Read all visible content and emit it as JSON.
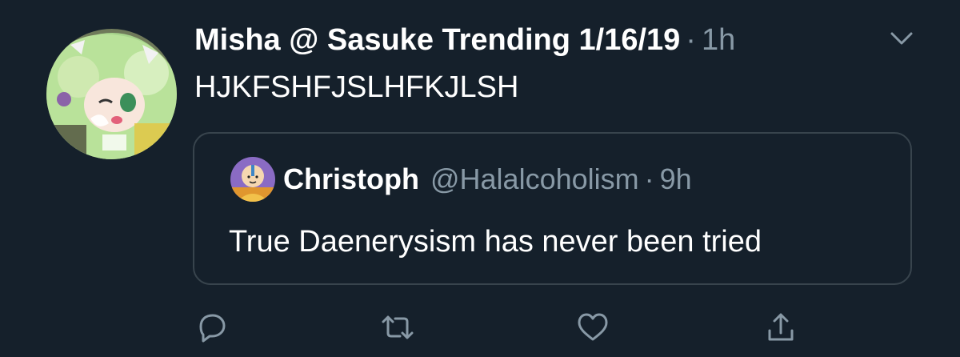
{
  "tweet": {
    "display_name": "Misha @ Sasuke Trending 1/16/19",
    "separator": "·",
    "time": "1h",
    "text": "HJKFSHFJSLHFKJLSH",
    "avatar_icon": "anime-character-avatar",
    "menu_icon": "chevron-down-icon"
  },
  "quoted": {
    "display_name": "Christoph",
    "handle": "@Halalcoholism",
    "separator": "·",
    "time": "9h",
    "text": "True Daenerysism has never been tried",
    "avatar_icon": "cartoon-monk-avatar"
  },
  "actions": [
    {
      "name": "reply",
      "icon": "reply-icon"
    },
    {
      "name": "retweet",
      "icon": "retweet-icon"
    },
    {
      "name": "like",
      "icon": "heart-icon"
    },
    {
      "name": "share",
      "icon": "share-icon"
    }
  ],
  "colors": {
    "background": "#15202b",
    "primary_text": "#ffffff",
    "secondary_text": "#8899a6",
    "border": "#38444d"
  }
}
